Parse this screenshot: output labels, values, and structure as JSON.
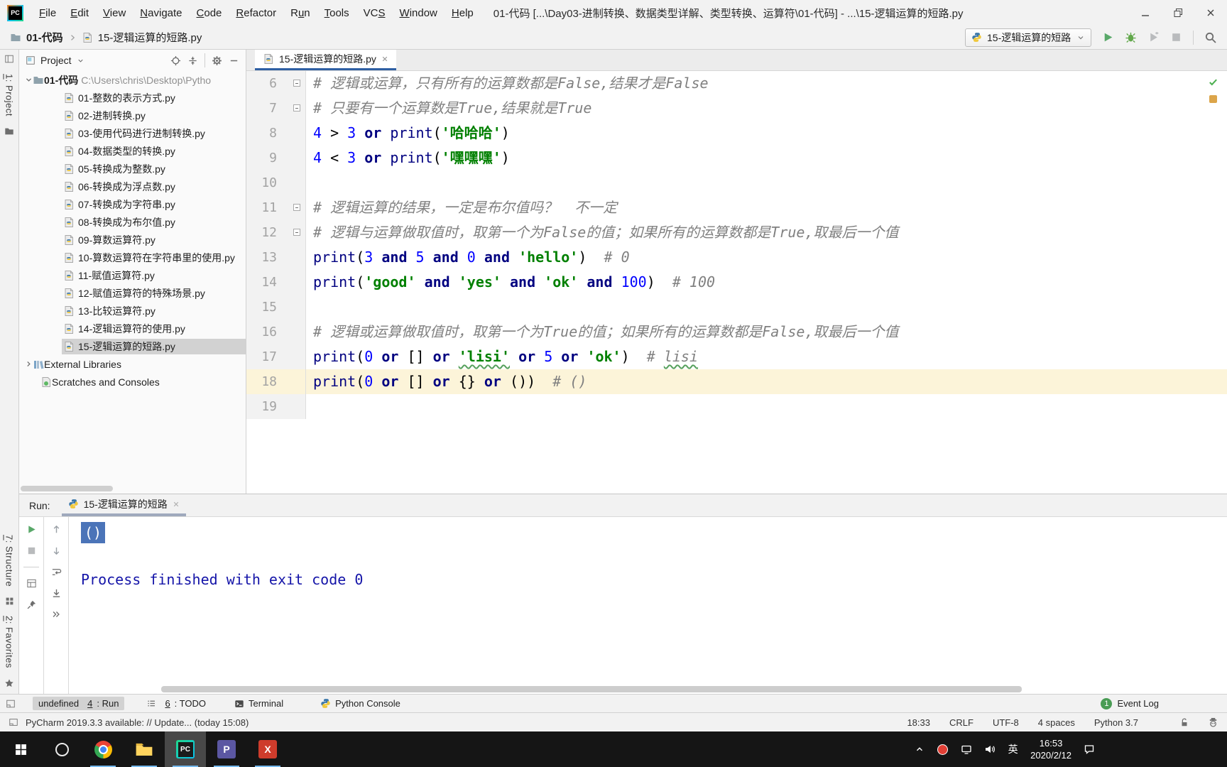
{
  "window": {
    "title": "01-代码 [...\\Day03-进制转换、数据类型详解、类型转换、运算符\\01-代码] - ...\\15-逻辑运算的短路.py"
  },
  "menubar": {
    "items": [
      {
        "pre": "",
        "u": "F",
        "rest": "ile"
      },
      {
        "pre": "",
        "u": "E",
        "rest": "dit"
      },
      {
        "pre": "",
        "u": "V",
        "rest": "iew"
      },
      {
        "pre": "",
        "u": "N",
        "rest": "avigate"
      },
      {
        "pre": "",
        "u": "C",
        "rest": "ode"
      },
      {
        "pre": "",
        "u": "R",
        "rest": "efactor"
      },
      {
        "pre": "R",
        "u": "u",
        "rest": "n"
      },
      {
        "pre": "",
        "u": "T",
        "rest": "ools"
      },
      {
        "pre": "VC",
        "u": "S",
        "rest": ""
      },
      {
        "pre": "",
        "u": "W",
        "rest": "indow"
      },
      {
        "pre": "",
        "u": "H",
        "rest": "elp"
      }
    ]
  },
  "navbar": {
    "breadcrumbs": [
      {
        "label": "01-代码"
      },
      {
        "label": "15-逻辑运算的短路.py"
      }
    ],
    "run_config": "15-逻辑运算的短路"
  },
  "stripe": {
    "top_label": {
      "pre": "",
      "u": "1",
      "rest": ": Project"
    },
    "bottom_labels": [
      {
        "pre": "",
        "u": "7",
        "rest": ": Structure"
      },
      {
        "pre": "",
        "u": "2",
        "rest": ": Favorites"
      }
    ]
  },
  "project": {
    "title": "Project",
    "root": {
      "name": "01-代码",
      "path": "C:\\Users\\chris\\Desktop\\Pytho"
    },
    "files": [
      "01-整数的表示方式.py",
      "02-进制转换.py",
      "03-使用代码进行进制转换.py",
      "04-数据类型的转换.py",
      "05-转换成为整数.py",
      "06-转换成为浮点数.py",
      "07-转换成为字符串.py",
      "08-转换成为布尔值.py",
      "09-算数运算符.py",
      "10-算数运算符在字符串里的使用.py",
      "11-赋值运算符.py",
      "12-赋值运算符的特殊场景.py",
      "13-比较运算符.py",
      "14-逻辑运算符的使用.py",
      "15-逻辑运算的短路.py"
    ],
    "selected_index": 14,
    "extra_nodes": [
      "External Libraries",
      "Scratches and Consoles"
    ]
  },
  "editor": {
    "tab": "15-逻辑运算的短路.py",
    "lines": [
      {
        "n": 6,
        "fold": "start",
        "tokens": [
          [
            "# 逻辑或运算，只有所有的运算数都是False,结果才是False",
            "cmt"
          ]
        ]
      },
      {
        "n": 7,
        "fold": "end",
        "tokens": [
          [
            "# 只要有一个运算数是True,结果就是True",
            "cmt"
          ]
        ]
      },
      {
        "n": 8,
        "tokens": [
          [
            "4",
            "num"
          ],
          [
            " > ",
            "pln"
          ],
          [
            "3",
            "num"
          ],
          [
            " ",
            "pln"
          ],
          [
            "or",
            "kw"
          ],
          [
            " ",
            "pln"
          ],
          [
            "print",
            "fn"
          ],
          [
            "(",
            "pln"
          ],
          [
            "'哈哈哈'",
            "str"
          ],
          [
            ")",
            "pln"
          ]
        ]
      },
      {
        "n": 9,
        "tokens": [
          [
            "4",
            "num"
          ],
          [
            " < ",
            "pln"
          ],
          [
            "3",
            "num"
          ],
          [
            " ",
            "pln"
          ],
          [
            "or",
            "kw"
          ],
          [
            " ",
            "pln"
          ],
          [
            "print",
            "fn"
          ],
          [
            "(",
            "pln"
          ],
          [
            "'嘿嘿嘿'",
            "str"
          ],
          [
            ")",
            "pln"
          ]
        ]
      },
      {
        "n": 10,
        "tokens": []
      },
      {
        "n": 11,
        "fold": "start",
        "tokens": [
          [
            "# 逻辑运算的结果，一定是布尔值吗？  不一定",
            "cmt"
          ]
        ]
      },
      {
        "n": 12,
        "fold": "end",
        "tokens": [
          [
            "# 逻辑与运算做取值时，取第一个为False的值；如果所有的运算数都是True,取最后一个值",
            "cmt"
          ]
        ]
      },
      {
        "n": 13,
        "tokens": [
          [
            "print",
            "fn"
          ],
          [
            "(",
            "pln"
          ],
          [
            "3",
            "num"
          ],
          [
            " ",
            "pln"
          ],
          [
            "and",
            "kw"
          ],
          [
            " ",
            "pln"
          ],
          [
            "5",
            "num"
          ],
          [
            " ",
            "pln"
          ],
          [
            "and",
            "kw"
          ],
          [
            " ",
            "pln"
          ],
          [
            "0",
            "num"
          ],
          [
            " ",
            "pln"
          ],
          [
            "and",
            "kw"
          ],
          [
            " ",
            "pln"
          ],
          [
            "'hello'",
            "str"
          ],
          [
            ")",
            "pln"
          ],
          [
            "  ",
            "pln"
          ],
          [
            "# 0",
            "cmt"
          ]
        ]
      },
      {
        "n": 14,
        "tokens": [
          [
            "print",
            "fn"
          ],
          [
            "(",
            "pln"
          ],
          [
            "'good'",
            "str"
          ],
          [
            " ",
            "pln"
          ],
          [
            "and",
            "kw"
          ],
          [
            " ",
            "pln"
          ],
          [
            "'yes'",
            "str"
          ],
          [
            " ",
            "pln"
          ],
          [
            "and",
            "kw"
          ],
          [
            " ",
            "pln"
          ],
          [
            "'ok'",
            "str"
          ],
          [
            " ",
            "pln"
          ],
          [
            "and",
            "kw"
          ],
          [
            " ",
            "pln"
          ],
          [
            "100",
            "num"
          ],
          [
            ")",
            "pln"
          ],
          [
            "  ",
            "pln"
          ],
          [
            "# 100",
            "cmt"
          ]
        ]
      },
      {
        "n": 15,
        "tokens": []
      },
      {
        "n": 16,
        "tokens": [
          [
            "# 逻辑或运算做取值时，取第一个为True的值；如果所有的运算数都是False,取最后一个值",
            "cmt"
          ]
        ]
      },
      {
        "n": 17,
        "tokens": [
          [
            "print",
            "fn"
          ],
          [
            "(",
            "pln"
          ],
          [
            "0",
            "num"
          ],
          [
            " ",
            "pln"
          ],
          [
            "or",
            "kw"
          ],
          [
            " [] ",
            "pln"
          ],
          [
            "or",
            "kw"
          ],
          [
            " ",
            "pln"
          ],
          [
            "'lisi'",
            "str sq"
          ],
          [
            " ",
            "pln"
          ],
          [
            "or",
            "kw"
          ],
          [
            " ",
            "pln"
          ],
          [
            "5",
            "num"
          ],
          [
            " ",
            "pln"
          ],
          [
            "or",
            "kw"
          ],
          [
            " ",
            "pln"
          ],
          [
            "'ok'",
            "str"
          ],
          [
            ")",
            "pln"
          ],
          [
            "  ",
            "pln"
          ],
          [
            "# ",
            "cmt"
          ],
          [
            "lisi",
            "cmt sq"
          ]
        ]
      },
      {
        "n": 18,
        "hl": true,
        "tokens": [
          [
            "print",
            "fn"
          ],
          [
            "(",
            "pln"
          ],
          [
            "0",
            "num"
          ],
          [
            " ",
            "pln"
          ],
          [
            "or",
            "kw"
          ],
          [
            " [] ",
            "pln"
          ],
          [
            "or",
            "kw"
          ],
          [
            " {} ",
            "pln"
          ],
          [
            "or",
            "kw"
          ],
          [
            " ()",
            "pln"
          ],
          [
            ")",
            "pln"
          ],
          [
            "  ",
            "pln"
          ],
          [
            "# ()",
            "cmt"
          ]
        ]
      },
      {
        "n": 19,
        "tokens": []
      }
    ]
  },
  "run": {
    "label": "Run:",
    "tab": "15-逻辑运算的短路",
    "console": {
      "selected_output": "()",
      "message": "Process finished with exit code 0"
    }
  },
  "toolwindow_bar": {
    "items": [
      {
        "icon": "run-small",
        "pre": "",
        "u": "4",
        "rest": ": Run",
        "active": true
      },
      {
        "icon": "todo",
        "pre": "",
        "u": "6",
        "rest": ": TODO",
        "active": false
      },
      {
        "icon": "terminal",
        "pre": "Terminal",
        "u": "",
        "rest": "",
        "active": false
      },
      {
        "icon": "pylogo",
        "pre": "Python Console",
        "u": "",
        "rest": "",
        "active": false
      }
    ],
    "event_log": {
      "label": "Event Log",
      "badge": "1"
    }
  },
  "status": {
    "message": "PyCharm 2019.3.3 available: // Update... (today 15:08)",
    "items": [
      "18:33",
      "CRLF",
      "UTF-8",
      "4 spaces",
      "Python 3.7"
    ]
  },
  "taskbar": {
    "ime": "英",
    "clock": {
      "time": "16:53",
      "date": "2020/2/12"
    }
  },
  "colors": {
    "accent_tab_underline": "#2e5fa3",
    "current_line_highlight": "#fcf4d9",
    "console_selection": "#4b74b8",
    "keyword": "#000080",
    "number": "#0000ff",
    "string": "#008000",
    "comment": "#808080",
    "run_green": "#59a869",
    "taskbar_bg": "#151515"
  }
}
